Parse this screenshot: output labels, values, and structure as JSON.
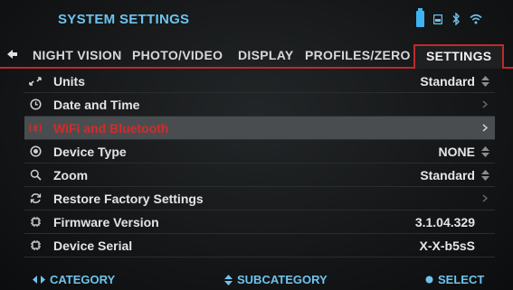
{
  "header": {
    "title": "SYSTEM SETTINGS",
    "status_icons": [
      "battery-icon",
      "sd-card-icon",
      "bluetooth-icon",
      "wifi-icon"
    ]
  },
  "tabs": [
    {
      "label": "NIGHT VISION",
      "active": false
    },
    {
      "label": "PHOTO/VIDEO",
      "active": false
    },
    {
      "label": "DISPLAY",
      "active": false
    },
    {
      "label": "PROFILES/ZERO",
      "active": false
    },
    {
      "label": "SETTINGS",
      "active": true
    }
  ],
  "rows": [
    {
      "icon": "units-icon",
      "label": "Units",
      "value": "Standard",
      "control": "updown"
    },
    {
      "icon": "clock-icon",
      "label": "Date and Time",
      "value": "",
      "control": "chevron"
    },
    {
      "icon": "wifi-bluetooth-icon",
      "label": "WiFi and Bluetooth",
      "value": "",
      "control": "chevron",
      "selected": true
    },
    {
      "icon": "device-icon",
      "label": "Device Type",
      "value": "NONE",
      "control": "updown"
    },
    {
      "icon": "zoom-icon",
      "label": "Zoom",
      "value": "Standard",
      "control": "updown"
    },
    {
      "icon": "restore-icon",
      "label": "Restore Factory Settings",
      "value": "",
      "control": "chevron"
    },
    {
      "icon": "chip-icon",
      "label": "Firmware Version",
      "value": "3.1.04.329",
      "control": "none"
    },
    {
      "icon": "chip-icon",
      "label": "Device Serial",
      "value": "X-X-b5sS",
      "control": "none"
    }
  ],
  "footer": {
    "category": "CATEGORY",
    "subcategory": "SUBCATEGORY",
    "select": "SELECT"
  },
  "colors": {
    "accent_blue": "#6ec3ee",
    "accent_red": "#c0292f",
    "selected_text": "#d62a2a"
  }
}
